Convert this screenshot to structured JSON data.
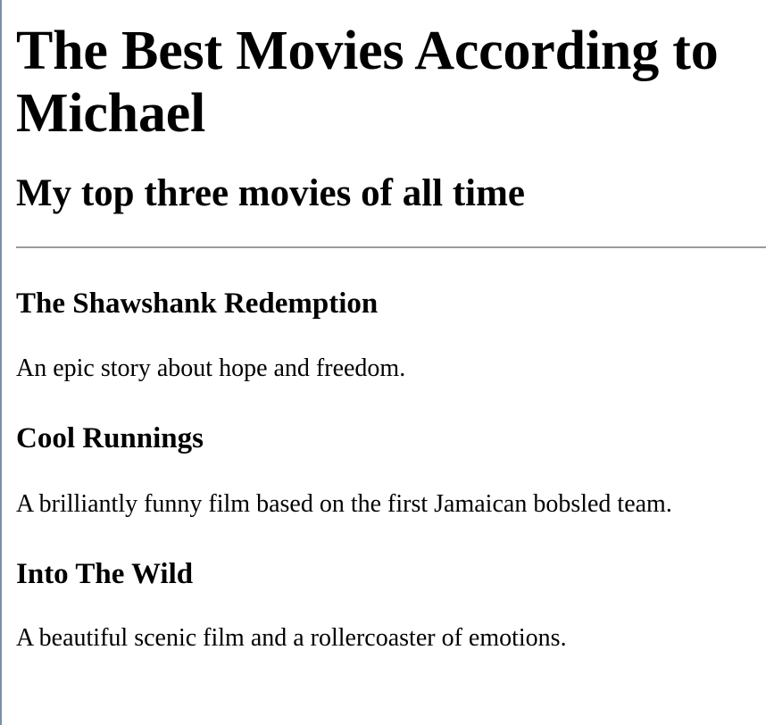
{
  "page": {
    "title": "The Best Movies According to Michael",
    "subtitle": "My top three movies of all time",
    "movies": [
      {
        "title": "The Shawshank Redemption",
        "description": "An epic story about hope and freedom."
      },
      {
        "title": "Cool Runnings",
        "description": "A brilliantly funny film based on the first Jamaican bobsled team."
      },
      {
        "title": "Into The Wild",
        "description": "A beautiful scenic film and a rollercoaster of emotions."
      }
    ]
  }
}
